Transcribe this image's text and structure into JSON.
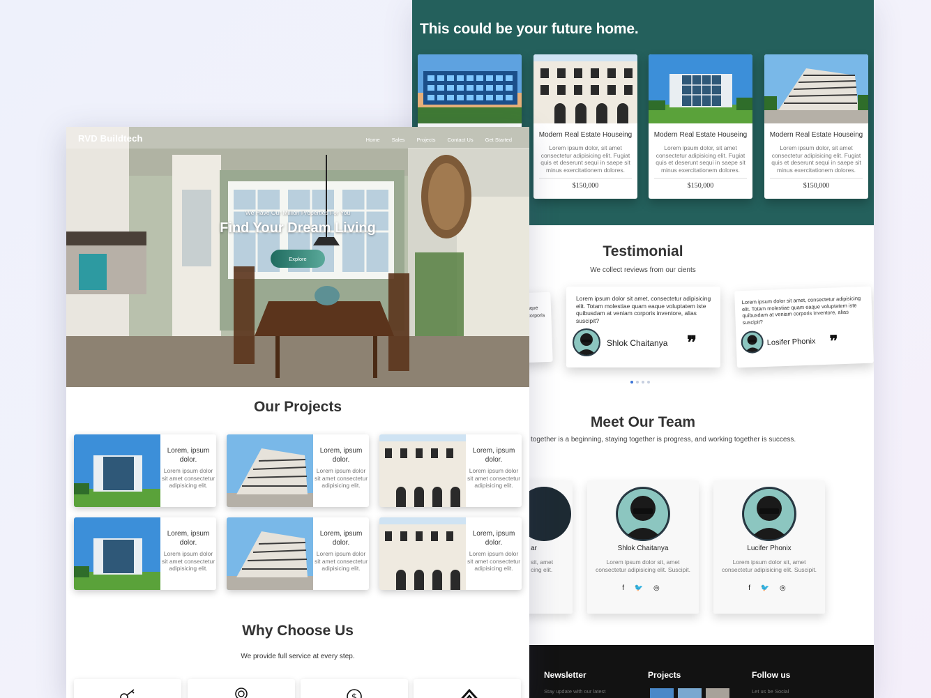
{
  "right": {
    "section_title": "This could be your future home.",
    "homes": [
      {
        "title": "",
        "text": "",
        "price": ""
      },
      {
        "title": "Modern Real Estate Houseing",
        "text": "Lorem ipsum dolor, sit amet consectetur adipisicing elit. Fugiat quis et deserunt sequi in saepe sit minus exercitationem dolores.",
        "price": "$150,000"
      },
      {
        "title": "Modern Real Estate Houseing",
        "text": "Lorem ipsum dolor, sit amet consectetur adipisicing elit. Fugiat quis et deserunt sequi in saepe sit minus exercitationem dolores.",
        "price": "$150,000"
      },
      {
        "title": "Modern Real Estate Houseing",
        "text": "Lorem ipsum dolor, sit amet consectetur adipisicing elit. Fugiat quis et deserunt sequi in saepe sit minus exercitationem dolores.",
        "price": "$150,000"
      }
    ],
    "testimonial": {
      "title": "Testimonial",
      "subtitle": "We collect reviews from our cients",
      "partial_text": "aque\ncorporis",
      "cards": [
        {
          "text": "Lorem ipsum dolor sit amet, consectetur adipisicing elit. Totam molestiae quam eaque voluptatem iste quibusdam at veniam corporis inventore, alias suscipit?",
          "name": "Shlok Chaitanya",
          "quote": "❞"
        },
        {
          "text": "Lorem ipsum dolor sit amet, consectetur adipisicing elit. Totam molestiae quam eaque voluptatem iste quibusdam at veniam corporis inventore, alias suscipit?",
          "name": "Losifer Phonix",
          "quote": "❞"
        }
      ]
    },
    "team": {
      "title": "Meet Our Team",
      "subtitle": "together is a beginning, staying together is progress, and working together is success.",
      "partial_name": "ar",
      "partial_text": "sit, amet\ncing elit.",
      "members": [
        {
          "name": "Shlok Chaitanya",
          "text": "Lorem ipsum dolor sit, amet consectetur adipisicing elit. Suscipit.",
          "social": "f 🐦 ◎"
        },
        {
          "name": "Lucifer Phonix",
          "text": "Lorem ipsum dolor sit, amet consectetur adipisicing elit. Suscipit.",
          "social": "f 🐦 ◎"
        }
      ]
    },
    "footer": {
      "newsletter": "Newsletter",
      "newsletter_text": "Stay update with our latest",
      "projects": "Projects",
      "follow": "Follow us",
      "follow_text": "Let us be Social"
    }
  },
  "left": {
    "brand": "RVD Buildtech",
    "nav": [
      "Home",
      "Sales",
      "Projects",
      "Contact Us",
      "Get Started"
    ],
    "hero_tag": "We Have Our Million Properties For You",
    "hero_title": "Find Your Dream Living",
    "explore": "Explore",
    "projects_title": "Our Projects",
    "project_cards": [
      {
        "title": "Lorem, ipsum dolor.",
        "text": "Lorem ipsum dolor sit amet consectetur adipisicing elit."
      },
      {
        "title": "Lorem, ipsum dolor.",
        "text": "Lorem ipsum dolor sit amet consectetur adipisicing elit."
      },
      {
        "title": "Lorem, ipsum dolor.",
        "text": "Lorem ipsum dolor sit amet consectetur adipisicing elit."
      },
      {
        "title": "Lorem, ipsum dolor.",
        "text": "Lorem ipsum dolor sit amet consectetur adipisicing elit."
      },
      {
        "title": "Lorem, ipsum dolor.",
        "text": "Lorem ipsum dolor sit amet consectetur adipisicing elit."
      },
      {
        "title": "Lorem, ipsum dolor.",
        "text": "Lorem ipsum dolor sit amet consectetur adipisicing elit."
      }
    ],
    "why_title": "Why Choose Us",
    "why_subtitle": "We provide full service at every step.",
    "why_icons": [
      "key-icon",
      "award-icon",
      "dollar-icon",
      "house-icon"
    ]
  },
  "colors": {
    "teal": "#24605c",
    "footer": "#121212",
    "accent_button": "#1f6b5f"
  }
}
